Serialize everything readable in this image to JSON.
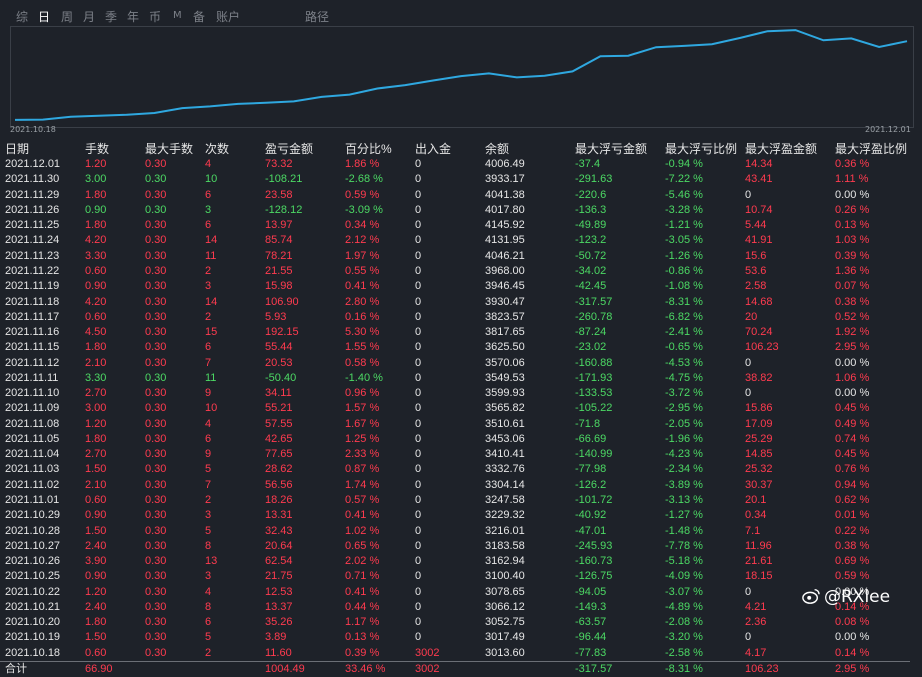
{
  "tabs": [
    {
      "label": "综",
      "active": false
    },
    {
      "label": "日",
      "active": true
    },
    {
      "label": "周",
      "active": false
    },
    {
      "label": "月",
      "active": false
    },
    {
      "label": "季",
      "active": false
    },
    {
      "label": "年",
      "active": false
    },
    {
      "label": "币",
      "active": false
    },
    {
      "label": "M",
      "active": false
    },
    {
      "label": "备",
      "active": false
    },
    {
      "label": "账户",
      "active": false
    },
    {
      "label": "路径",
      "active": false
    }
  ],
  "chart": {
    "x_start": "2021.10.18",
    "x_end": "2021.12.01",
    "line_color": "#2fa8e0"
  },
  "chart_data": {
    "type": "line",
    "x": [
      "2021.10.18",
      "2021.10.19",
      "2021.10.20",
      "2021.10.21",
      "2021.10.22",
      "2021.10.25",
      "2021.10.26",
      "2021.10.27",
      "2021.10.28",
      "2021.10.29",
      "2021.11.01",
      "2021.11.02",
      "2021.11.03",
      "2021.11.04",
      "2021.11.05",
      "2021.11.08",
      "2021.11.09",
      "2021.11.10",
      "2021.11.11",
      "2021.11.12",
      "2021.11.15",
      "2021.11.16",
      "2021.11.17",
      "2021.11.18",
      "2021.11.19",
      "2021.11.22",
      "2021.11.23",
      "2021.11.24",
      "2021.11.25",
      "2021.11.26",
      "2021.11.29",
      "2021.11.30",
      "2021.12.01"
    ],
    "values": [
      3013.6,
      3017.49,
      3052.75,
      3066.12,
      3078.65,
      3100.4,
      3162.94,
      3183.58,
      3216.01,
      3229.32,
      3247.58,
      3304.14,
      3332.76,
      3410.41,
      3453.06,
      3510.61,
      3565.82,
      3599.93,
      3549.53,
      3570.06,
      3625.5,
      3817.65,
      3823.57,
      3930.47,
      3946.45,
      3968.0,
      4046.21,
      4131.95,
      4145.92,
      4017.8,
      4041.38,
      3933.17,
      4006.49
    ],
    "series_color": "#2fa8e0"
  },
  "table": {
    "headers": [
      "日期",
      "手数",
      "最大手数",
      "次数",
      "盈亏金额",
      "百分比%",
      "出入金",
      "余额",
      "最大浮亏金额",
      "最大浮亏比例",
      "最大浮盈金额",
      "最大浮盈比例"
    ],
    "rows": [
      {
        "date": "2021.12.01",
        "lots": "1.20",
        "max_lots": "0.30",
        "count": "4",
        "pnl": "73.32",
        "pct": "1.86 %",
        "io": "0",
        "balance": "4006.49",
        "mfl": "-37.4",
        "mflp": "-0.94 %",
        "mfp": "14.34",
        "mfpp": "0.36 %",
        "win": true
      },
      {
        "date": "2021.11.30",
        "lots": "3.00",
        "max_lots": "0.30",
        "count": "10",
        "pnl": "-108.21",
        "pct": "-2.68 %",
        "io": "0",
        "balance": "3933.17",
        "mfl": "-291.63",
        "mflp": "-7.22 %",
        "mfp": "43.41",
        "mfpp": "1.11 %",
        "win": false
      },
      {
        "date": "2021.11.29",
        "lots": "1.80",
        "max_lots": "0.30",
        "count": "6",
        "pnl": "23.58",
        "pct": "0.59 %",
        "io": "0",
        "balance": "4041.38",
        "mfl": "-220.6",
        "mflp": "-5.46 %",
        "mfp": "0",
        "mfpp": "0.00 %",
        "win": true
      },
      {
        "date": "2021.11.26",
        "lots": "0.90",
        "max_lots": "0.30",
        "count": "3",
        "pnl": "-128.12",
        "pct": "-3.09 %",
        "io": "0",
        "balance": "4017.80",
        "mfl": "-136.3",
        "mflp": "-3.28 %",
        "mfp": "10.74",
        "mfpp": "0.26 %",
        "win": false
      },
      {
        "date": "2021.11.25",
        "lots": "1.80",
        "max_lots": "0.30",
        "count": "6",
        "pnl": "13.97",
        "pct": "0.34 %",
        "io": "0",
        "balance": "4145.92",
        "mfl": "-49.89",
        "mflp": "-1.21 %",
        "mfp": "5.44",
        "mfpp": "0.13 %",
        "win": true
      },
      {
        "date": "2021.11.24",
        "lots": "4.20",
        "max_lots": "0.30",
        "count": "14",
        "pnl": "85.74",
        "pct": "2.12 %",
        "io": "0",
        "balance": "4131.95",
        "mfl": "-123.2",
        "mflp": "-3.05 %",
        "mfp": "41.91",
        "mfpp": "1.03 %",
        "win": true
      },
      {
        "date": "2021.11.23",
        "lots": "3.30",
        "max_lots": "0.30",
        "count": "11",
        "pnl": "78.21",
        "pct": "1.97 %",
        "io": "0",
        "balance": "4046.21",
        "mfl": "-50.72",
        "mflp": "-1.26 %",
        "mfp": "15.6",
        "mfpp": "0.39 %",
        "win": true
      },
      {
        "date": "2021.11.22",
        "lots": "0.60",
        "max_lots": "0.30",
        "count": "2",
        "pnl": "21.55",
        "pct": "0.55 %",
        "io": "0",
        "balance": "3968.00",
        "mfl": "-34.02",
        "mflp": "-0.86 %",
        "mfp": "53.6",
        "mfpp": "1.36 %",
        "win": true
      },
      {
        "date": "2021.11.19",
        "lots": "0.90",
        "max_lots": "0.30",
        "count": "3",
        "pnl": "15.98",
        "pct": "0.41 %",
        "io": "0",
        "balance": "3946.45",
        "mfl": "-42.45",
        "mflp": "-1.08 %",
        "mfp": "2.58",
        "mfpp": "0.07 %",
        "win": true
      },
      {
        "date": "2021.11.18",
        "lots": "4.20",
        "max_lots": "0.30",
        "count": "14",
        "pnl": "106.90",
        "pct": "2.80 %",
        "io": "0",
        "balance": "3930.47",
        "mfl": "-317.57",
        "mflp": "-8.31 %",
        "mfp": "14.68",
        "mfpp": "0.38 %",
        "win": true
      },
      {
        "date": "2021.11.17",
        "lots": "0.60",
        "max_lots": "0.30",
        "count": "2",
        "pnl": "5.93",
        "pct": "0.16 %",
        "io": "0",
        "balance": "3823.57",
        "mfl": "-260.78",
        "mflp": "-6.82 %",
        "mfp": "20",
        "mfpp": "0.52 %",
        "win": true
      },
      {
        "date": "2021.11.16",
        "lots": "4.50",
        "max_lots": "0.30",
        "count": "15",
        "pnl": "192.15",
        "pct": "5.30 %",
        "io": "0",
        "balance": "3817.65",
        "mfl": "-87.24",
        "mflp": "-2.41 %",
        "mfp": "70.24",
        "mfpp": "1.92 %",
        "win": true
      },
      {
        "date": "2021.11.15",
        "lots": "1.80",
        "max_lots": "0.30",
        "count": "6",
        "pnl": "55.44",
        "pct": "1.55 %",
        "io": "0",
        "balance": "3625.50",
        "mfl": "-23.02",
        "mflp": "-0.65 %",
        "mfp": "106.23",
        "mfpp": "2.95 %",
        "win": true
      },
      {
        "date": "2021.11.12",
        "lots": "2.10",
        "max_lots": "0.30",
        "count": "7",
        "pnl": "20.53",
        "pct": "0.58 %",
        "io": "0",
        "balance": "3570.06",
        "mfl": "-160.88",
        "mflp": "-4.53 %",
        "mfp": "0",
        "mfpp": "0.00 %",
        "win": true
      },
      {
        "date": "2021.11.11",
        "lots": "3.30",
        "max_lots": "0.30",
        "count": "11",
        "pnl": "-50.40",
        "pct": "-1.40 %",
        "io": "0",
        "balance": "3549.53",
        "mfl": "-171.93",
        "mflp": "-4.75 %",
        "mfp": "38.82",
        "mfpp": "1.06 %",
        "win": false
      },
      {
        "date": "2021.11.10",
        "lots": "2.70",
        "max_lots": "0.30",
        "count": "9",
        "pnl": "34.11",
        "pct": "0.96 %",
        "io": "0",
        "balance": "3599.93",
        "mfl": "-133.53",
        "mflp": "-3.72 %",
        "mfp": "0",
        "mfpp": "0.00 %",
        "win": true
      },
      {
        "date": "2021.11.09",
        "lots": "3.00",
        "max_lots": "0.30",
        "count": "10",
        "pnl": "55.21",
        "pct": "1.57 %",
        "io": "0",
        "balance": "3565.82",
        "mfl": "-105.22",
        "mflp": "-2.95 %",
        "mfp": "15.86",
        "mfpp": "0.45 %",
        "win": true
      },
      {
        "date": "2021.11.08",
        "lots": "1.20",
        "max_lots": "0.30",
        "count": "4",
        "pnl": "57.55",
        "pct": "1.67 %",
        "io": "0",
        "balance": "3510.61",
        "mfl": "-71.8",
        "mflp": "-2.05 %",
        "mfp": "17.09",
        "mfpp": "0.49 %",
        "win": true
      },
      {
        "date": "2021.11.05",
        "lots": "1.80",
        "max_lots": "0.30",
        "count": "6",
        "pnl": "42.65",
        "pct": "1.25 %",
        "io": "0",
        "balance": "3453.06",
        "mfl": "-66.69",
        "mflp": "-1.96 %",
        "mfp": "25.29",
        "mfpp": "0.74 %",
        "win": true
      },
      {
        "date": "2021.11.04",
        "lots": "2.70",
        "max_lots": "0.30",
        "count": "9",
        "pnl": "77.65",
        "pct": "2.33 %",
        "io": "0",
        "balance": "3410.41",
        "mfl": "-140.99",
        "mflp": "-4.23 %",
        "mfp": "14.85",
        "mfpp": "0.45 %",
        "win": true
      },
      {
        "date": "2021.11.03",
        "lots": "1.50",
        "max_lots": "0.30",
        "count": "5",
        "pnl": "28.62",
        "pct": "0.87 %",
        "io": "0",
        "balance": "3332.76",
        "mfl": "-77.98",
        "mflp": "-2.34 %",
        "mfp": "25.32",
        "mfpp": "0.76 %",
        "win": true
      },
      {
        "date": "2021.11.02",
        "lots": "2.10",
        "max_lots": "0.30",
        "count": "7",
        "pnl": "56.56",
        "pct": "1.74 %",
        "io": "0",
        "balance": "3304.14",
        "mfl": "-126.2",
        "mflp": "-3.89 %",
        "mfp": "30.37",
        "mfpp": "0.94 %",
        "win": true
      },
      {
        "date": "2021.11.01",
        "lots": "0.60",
        "max_lots": "0.30",
        "count": "2",
        "pnl": "18.26",
        "pct": "0.57 %",
        "io": "0",
        "balance": "3247.58",
        "mfl": "-101.72",
        "mflp": "-3.13 %",
        "mfp": "20.1",
        "mfpp": "0.62 %",
        "win": true
      },
      {
        "date": "2021.10.29",
        "lots": "0.90",
        "max_lots": "0.30",
        "count": "3",
        "pnl": "13.31",
        "pct": "0.41 %",
        "io": "0",
        "balance": "3229.32",
        "mfl": "-40.92",
        "mflp": "-1.27 %",
        "mfp": "0.34",
        "mfpp": "0.01 %",
        "win": true
      },
      {
        "date": "2021.10.28",
        "lots": "1.50",
        "max_lots": "0.30",
        "count": "5",
        "pnl": "32.43",
        "pct": "1.02 %",
        "io": "0",
        "balance": "3216.01",
        "mfl": "-47.01",
        "mflp": "-1.48 %",
        "mfp": "7.1",
        "mfpp": "0.22 %",
        "win": true
      },
      {
        "date": "2021.10.27",
        "lots": "2.40",
        "max_lots": "0.30",
        "count": "8",
        "pnl": "20.64",
        "pct": "0.65 %",
        "io": "0",
        "balance": "3183.58",
        "mfl": "-245.93",
        "mflp": "-7.78 %",
        "mfp": "11.96",
        "mfpp": "0.38 %",
        "win": true
      },
      {
        "date": "2021.10.26",
        "lots": "3.90",
        "max_lots": "0.30",
        "count": "13",
        "pnl": "62.54",
        "pct": "2.02 %",
        "io": "0",
        "balance": "3162.94",
        "mfl": "-160.73",
        "mflp": "-5.18 %",
        "mfp": "21.61",
        "mfpp": "0.69 %",
        "win": true
      },
      {
        "date": "2021.10.25",
        "lots": "0.90",
        "max_lots": "0.30",
        "count": "3",
        "pnl": "21.75",
        "pct": "0.71 %",
        "io": "0",
        "balance": "3100.40",
        "mfl": "-126.75",
        "mflp": "-4.09 %",
        "mfp": "18.15",
        "mfpp": "0.59 %",
        "win": true
      },
      {
        "date": "2021.10.22",
        "lots": "1.20",
        "max_lots": "0.30",
        "count": "4",
        "pnl": "12.53",
        "pct": "0.41 %",
        "io": "0",
        "balance": "3078.65",
        "mfl": "-94.05",
        "mflp": "-3.07 %",
        "mfp": "0",
        "mfpp": "0.00 %",
        "win": true
      },
      {
        "date": "2021.10.21",
        "lots": "2.40",
        "max_lots": "0.30",
        "count": "8",
        "pnl": "13.37",
        "pct": "0.44 %",
        "io": "0",
        "balance": "3066.12",
        "mfl": "-149.3",
        "mflp": "-4.89 %",
        "mfp": "4.21",
        "mfpp": "0.14 %",
        "win": true
      },
      {
        "date": "2021.10.20",
        "lots": "1.80",
        "max_lots": "0.30",
        "count": "6",
        "pnl": "35.26",
        "pct": "1.17 %",
        "io": "0",
        "balance": "3052.75",
        "mfl": "-63.57",
        "mflp": "-2.08 %",
        "mfp": "2.36",
        "mfpp": "0.08 %",
        "win": true
      },
      {
        "date": "2021.10.19",
        "lots": "1.50",
        "max_lots": "0.30",
        "count": "5",
        "pnl": "3.89",
        "pct": "0.13 %",
        "io": "0",
        "balance": "3017.49",
        "mfl": "-96.44",
        "mflp": "-3.20 %",
        "mfp": "0",
        "mfpp": "0.00 %",
        "win": true
      },
      {
        "date": "2021.10.18",
        "lots": "0.60",
        "max_lots": "0.30",
        "count": "2",
        "pnl": "11.60",
        "pct": "0.39 %",
        "io": "3002",
        "balance": "3013.60",
        "mfl": "-77.83",
        "mflp": "-2.58 %",
        "mfp": "4.17",
        "mfpp": "0.14 %",
        "win": true
      }
    ],
    "total": {
      "date": "合计",
      "lots": "66.90",
      "max_lots": "",
      "count": "",
      "pnl": "1004.49",
      "pct": "33.46 %",
      "io": "3002",
      "balance": "",
      "mfl": "-317.57",
      "mflp": "-8.31 %",
      "mfp": "106.23",
      "mfpp": "2.95 %"
    }
  },
  "colors": {
    "win": "#ff3b4f",
    "loss": "#4cd964",
    "neutral": "#e6e6e6",
    "background": "#1e2229"
  },
  "watermark": {
    "text": "@RXlee",
    "icon": "weibo-icon"
  }
}
